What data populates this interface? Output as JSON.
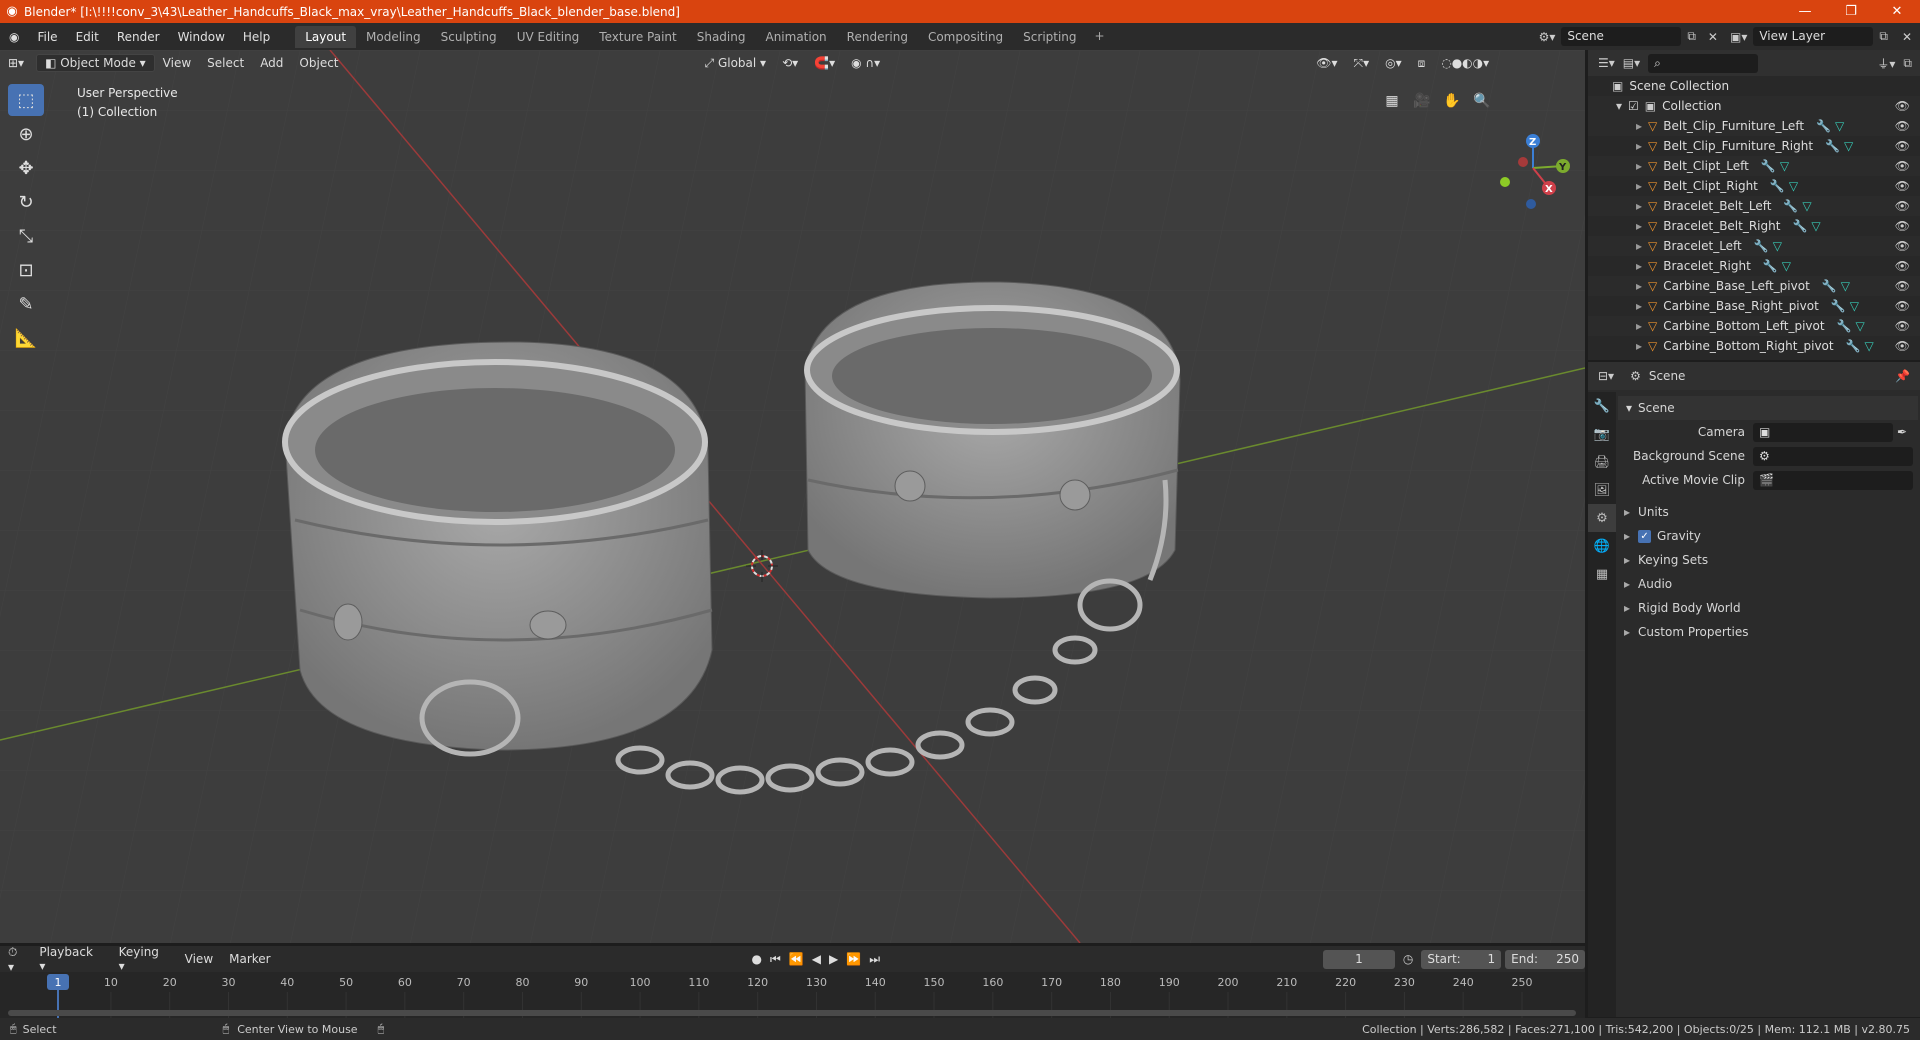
{
  "window": {
    "title": "Blender* [I:\\!!!!conv_3\\43\\Leather_Handcuffs_Black_max_vray\\Leather_Handcuffs_Black_blender_base.blend]",
    "minimize": "—",
    "restore": "❐",
    "close": "✕"
  },
  "menu": [
    "File",
    "Edit",
    "Render",
    "Window",
    "Help"
  ],
  "workspaces": [
    "Layout",
    "Modeling",
    "Sculpting",
    "UV Editing",
    "Texture Paint",
    "Shading",
    "Animation",
    "Rendering",
    "Compositing",
    "Scripting"
  ],
  "scene_field": "Scene",
  "view_layer_field": "View Layer",
  "viewport": {
    "mode": "Object Mode",
    "menus": [
      "View",
      "Select",
      "Add",
      "Object"
    ],
    "transform_orientation": "Global",
    "overlay_line1": "User Perspective",
    "overlay_line2": "(1) Collection",
    "gizmo": {
      "z": "Z",
      "y": "Y",
      "x": "X"
    }
  },
  "outliner": {
    "root": "Scene Collection",
    "collection": "Collection",
    "items": [
      "Belt_Clip_Furniture_Left",
      "Belt_Clip_Furniture_Right",
      "Belt_Clipt_Left",
      "Belt_Clipt_Right",
      "Bracelet_Belt_Left",
      "Bracelet_Belt_Right",
      "Bracelet_Left",
      "Bracelet_Right",
      "Carbine_Base_Left_pivot",
      "Carbine_Base_Right_pivot",
      "Carbine_Bottom_Left_pivot",
      "Carbine_Bottom_Right_pivot"
    ]
  },
  "properties": {
    "header": "Scene",
    "panel_title": "Scene",
    "fields": [
      {
        "label": "Camera"
      },
      {
        "label": "Background Scene"
      },
      {
        "label": "Active Movie Clip"
      }
    ],
    "sections": [
      "Units",
      "Gravity",
      "Keying Sets",
      "Audio",
      "Rigid Body World",
      "Custom Properties"
    ],
    "gravity_checked": true
  },
  "timeline": {
    "menus": [
      "Playback",
      "Keying",
      "View",
      "Marker"
    ],
    "current_frame": "1",
    "start_label": "Start:",
    "start": "1",
    "end_label": "End:",
    "end": "250",
    "ruler": [
      "1",
      "10",
      "20",
      "30",
      "40",
      "50",
      "60",
      "70",
      "80",
      "90",
      "100",
      "110",
      "120",
      "130",
      "140",
      "150",
      "160",
      "170",
      "180",
      "190",
      "200",
      "210",
      "220",
      "230",
      "240",
      "250"
    ]
  },
  "status": {
    "left1": "Select",
    "left2": "Center View to Mouse",
    "right": "Collection | Verts:286,582 | Faces:271,100 | Tris:542,200 | Objects:0/25 | Mem: 112.1 MB | v2.80.75"
  }
}
